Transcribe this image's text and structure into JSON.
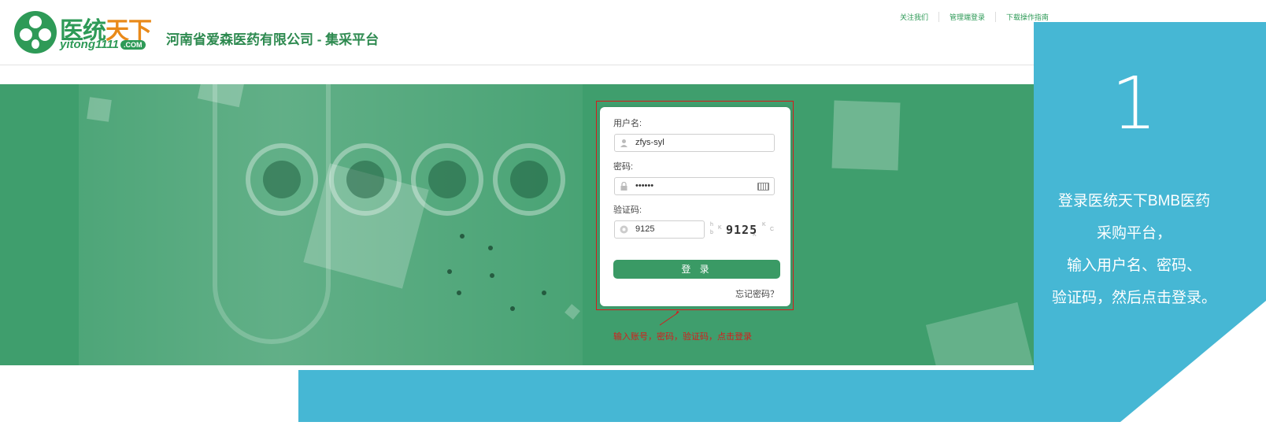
{
  "header": {
    "logo_cn_green": "医统",
    "logo_cn_orange": "天下",
    "logo_en": "yitong1111",
    "logo_com": ".COM",
    "company": "河南省爱森医药有限公司 - 集采平台",
    "links": [
      "关注我们",
      "管理端登录",
      "下载操作指南"
    ]
  },
  "login": {
    "username_label": "用户名:",
    "username_value": "zfys-syl",
    "password_label": "密码:",
    "password_value": "••••••",
    "captcha_label": "验证码:",
    "captcha_value": "9125",
    "captcha_image_text": "9125",
    "login_button": "登 录",
    "forgot_link": "忘记密码？"
  },
  "annotation": {
    "note": "输入账号，密码，验证码，点击登录"
  },
  "step": {
    "number": "1",
    "lines": [
      "登录医统天下BMB医药",
      "采购平台，",
      "输入用户名、密码、",
      "验证码，然后点击登录。"
    ]
  },
  "colors": {
    "brand_green": "#2e9a57",
    "banner_green": "#3f9e6d",
    "button_green": "#3a9a65",
    "accent_blue": "#46b7d4",
    "annotation_red": "#d61c1c"
  }
}
